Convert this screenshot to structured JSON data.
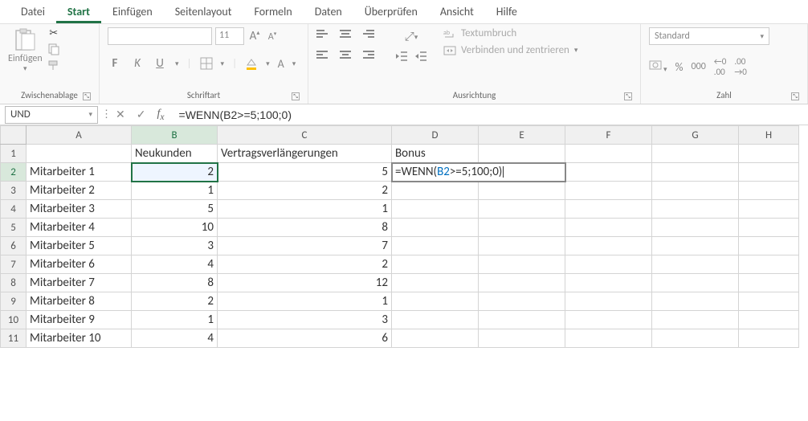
{
  "tabs": {
    "datei": "Datei",
    "start": "Start",
    "einfuegen": "Einfügen",
    "seitenlayout": "Seitenlayout",
    "formeln": "Formeln",
    "daten": "Daten",
    "ueberpruefen": "Überprüfen",
    "ansicht": "Ansicht",
    "hilfe": "Hilfe"
  },
  "ribbon": {
    "clipboard": {
      "paste": "Einfügen",
      "group": "Zwischenablage"
    },
    "font": {
      "size": "11",
      "bold": "F",
      "italic": "K",
      "underline": "U",
      "group": "Schriftart",
      "grow": "A",
      "shrink": "A"
    },
    "align": {
      "wrap": "Textumbruch",
      "merge": "Verbinden und zentrieren",
      "group": "Ausrichtung"
    },
    "number": {
      "format": "Standard",
      "group": "Zahl",
      "thousands": "000"
    }
  },
  "namebox": "UND",
  "formula": "=WENN(B2>=5;100;0)",
  "headers": {
    "A": "",
    "B": "Neukunden",
    "C": "Vertragsverlängerungen",
    "D": "Bonus"
  },
  "cols": [
    "A",
    "B",
    "C",
    "D",
    "E",
    "F",
    "G",
    "H"
  ],
  "rows": [
    {
      "n": 1,
      "A": "",
      "B": "Neukunden",
      "C": "Vertragsverlängerungen",
      "D": "Bonus"
    },
    {
      "n": 2,
      "A": "Mitarbeiter 1",
      "B": "2",
      "C": "5",
      "D_formula_prefix": "=WENN(",
      "D_formula_ref": "B2",
      "D_formula_suffix": ">=5;100;0)"
    },
    {
      "n": 3,
      "A": "Mitarbeiter 2",
      "B": "1",
      "C": "2"
    },
    {
      "n": 4,
      "A": "Mitarbeiter 3",
      "B": "5",
      "C": "1"
    },
    {
      "n": 5,
      "A": "Mitarbeiter 4",
      "B": "10",
      "C": "8"
    },
    {
      "n": 6,
      "A": "Mitarbeiter 5",
      "B": "3",
      "C": "7"
    },
    {
      "n": 7,
      "A": "Mitarbeiter 6",
      "B": "4",
      "C": "2"
    },
    {
      "n": 8,
      "A": "Mitarbeiter 7",
      "B": "8",
      "C": "12"
    },
    {
      "n": 9,
      "A": "Mitarbeiter 8",
      "B": "2",
      "C": "1"
    },
    {
      "n": 10,
      "A": "Mitarbeiter 9",
      "B": "1",
      "C": "3"
    },
    {
      "n": 11,
      "A": "Mitarbeiter 10",
      "B": "4",
      "C": "6"
    }
  ]
}
